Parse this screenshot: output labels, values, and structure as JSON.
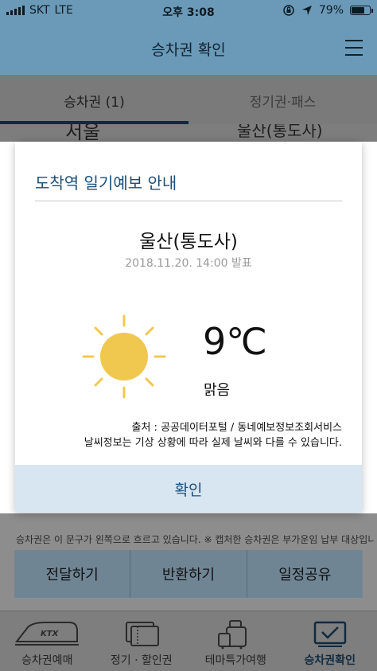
{
  "status_bar": {
    "carrier": "SKT",
    "network": "LTE",
    "time": "오후 3:08",
    "battery": "79%",
    "battery_level": 0.79
  },
  "header": {
    "title": "승차권 확인"
  },
  "tabs": [
    {
      "label": "승차권 (1)"
    },
    {
      "label": "정기권·패스"
    }
  ],
  "behind": {
    "left_fragment": "서울",
    "right_fragment": "울산(통도사)"
  },
  "notice": "승차권은 이 문구가 왼쪽으로 흐르고 있습니다. ※ 캡처한 승차권은 부가운임 납부 대상입니다.",
  "actions": [
    {
      "label": "전달하기"
    },
    {
      "label": "반환하기"
    },
    {
      "label": "일정공유"
    }
  ],
  "bottom_nav": [
    {
      "label": "승차권예매",
      "icon": "ktx-train-icon",
      "badge": "KTX"
    },
    {
      "label": "정기 · 할인권",
      "icon": "tickets-icon"
    },
    {
      "label": "테마특가여행",
      "icon": "luggage-icon"
    },
    {
      "label": "승차권확인",
      "icon": "ticket-check-icon"
    }
  ],
  "modal": {
    "title": "도착역 일기예보 안내",
    "location": "울산(통도사)",
    "announced": "2018.11.20. 14:00 발표",
    "temperature": "9℃",
    "condition": "맑음",
    "weather_icon": "sun-icon",
    "source_line1": "출처 : 공공데이터포털 / 동네예보정보조회서비스",
    "source_line2": "날씨정보는 기상 상황에 따라 실제 날씨와 다를 수 있습니다.",
    "confirm_label": "확인"
  },
  "colors": {
    "header": "#6a9ab8",
    "accent": "#1c4f78",
    "sun": "#f0c850",
    "confirm_bg": "#d8e6f2"
  }
}
